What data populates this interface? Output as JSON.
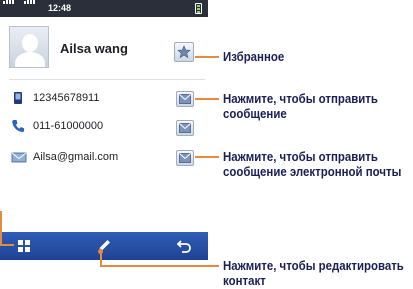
{
  "status_bar": {
    "time": "12:48"
  },
  "contact": {
    "name": "Ailsa wang",
    "phone": "12345678911",
    "landline": "011-61000000",
    "email": "Ailsa@gmail.com"
  },
  "icons": {
    "favorite": "star-icon",
    "phone": "mobile-phone-icon",
    "landline": "telephone-icon",
    "email": "email-icon",
    "message": "envelope-icon",
    "menu": "grid-menu-icon",
    "edit": "pencil-icon",
    "back": "back-arrow-icon"
  },
  "callouts": {
    "favorite": "Избранное",
    "send_message": [
      "Нажмите, чтобы отправить",
      "сообщение"
    ],
    "send_email": [
      "Нажмите, чтобы отправить",
      "сообщение электронной почты"
    ],
    "edit_contact": [
      "Нажмите, чтобы редактировать",
      "контакт"
    ]
  },
  "colors": {
    "status_bar": "#2a2f3a",
    "toolbar": "#1f4393",
    "callout_line": "#e8893c",
    "callout_text": "#1a1f55"
  }
}
